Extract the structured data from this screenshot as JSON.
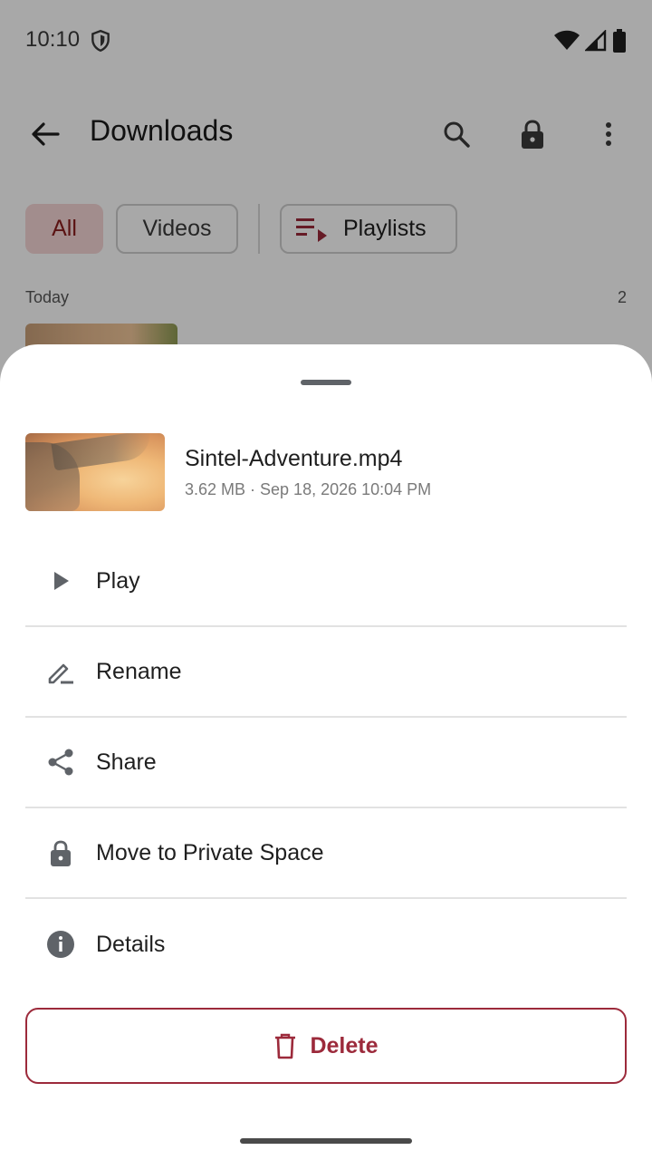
{
  "status_bar": {
    "time": "10:10"
  },
  "app_bar": {
    "title": "Downloads"
  },
  "filters": {
    "all": "All",
    "videos": "Videos",
    "playlists": "Playlists"
  },
  "section": {
    "label": "Today",
    "count": "2"
  },
  "sheet": {
    "file": {
      "name": "Sintel-Adventure.mp4",
      "meta": "3.62 MB · Sep 18, 2026 10:04 PM"
    },
    "actions": [
      {
        "label": "Play",
        "icon": "play-icon"
      },
      {
        "label": "Rename",
        "icon": "edit-icon"
      },
      {
        "label": "Share",
        "icon": "share-icon"
      },
      {
        "label": "Move to Private Space",
        "icon": "lock-icon"
      },
      {
        "label": "Details",
        "icon": "info-icon"
      }
    ],
    "delete_label": "Delete"
  },
  "colors": {
    "accent": "#9c2a3b",
    "chip_selected_bg": "#f6d7d7",
    "chip_selected_text": "#8a1e1e"
  }
}
